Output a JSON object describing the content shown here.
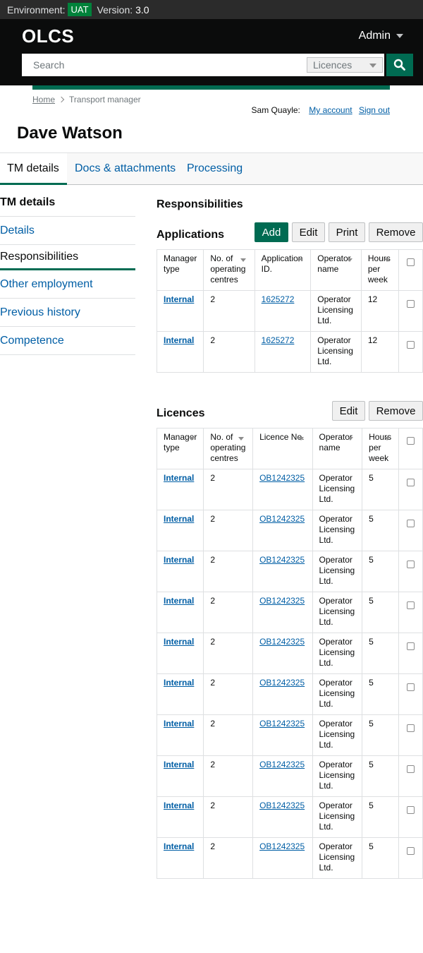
{
  "env": {
    "label": "Environment:",
    "badge": "UAT",
    "version_label": "Version:",
    "version": "3.0"
  },
  "header": {
    "logo": "OLCS",
    "admin": "Admin",
    "search_placeholder": "Search",
    "search_scope": "Licences"
  },
  "breadcrumb": {
    "home": "Home",
    "current": "Transport manager"
  },
  "user": {
    "name": "Sam Quayle:",
    "my_account": "My account",
    "sign_out": "Sign out"
  },
  "page_title": "Dave Watson",
  "tabs": [
    {
      "label": "TM details"
    },
    {
      "label": "Docs & attachments"
    },
    {
      "label": "Processing"
    }
  ],
  "sidenav": {
    "heading": "TM details",
    "items": [
      {
        "label": "Details"
      },
      {
        "label": "Responsibilities"
      },
      {
        "label": "Other employment"
      },
      {
        "label": "Previous history"
      },
      {
        "label": "Competence"
      }
    ]
  },
  "responsibilities_title": "Responsibilities",
  "applications": {
    "title": "Applications",
    "buttons": {
      "add": "Add",
      "edit": "Edit",
      "print": "Print",
      "remove": "Remove"
    },
    "headers": {
      "manager_type": "Manager type",
      "centres": "No. of operating centres",
      "app_id": "Application ID.",
      "operator": "Operator name",
      "hours": "Hours per week"
    },
    "rows": [
      {
        "manager_type": "Internal",
        "centres": "2",
        "app_id": "1625272",
        "operator": "Operator Licensing Ltd.",
        "hours": "12"
      },
      {
        "manager_type": "Internal",
        "centres": "2",
        "app_id": "1625272",
        "operator": "Operator Licensing Ltd.",
        "hours": "12"
      }
    ]
  },
  "licences": {
    "title": "Licences",
    "buttons": {
      "edit": "Edit",
      "remove": "Remove"
    },
    "headers": {
      "manager_type": "Manager type",
      "centres": "No. of operating centres",
      "lic_no": "Licence No.",
      "operator": "Operator name",
      "hours": "Hours per week"
    },
    "rows": [
      {
        "manager_type": "Internal",
        "centres": "2",
        "lic_no": "OB1242325",
        "operator": "Operator Licensing Ltd.",
        "hours": "5"
      },
      {
        "manager_type": "Internal",
        "centres": "2",
        "lic_no": "OB1242325",
        "operator": "Operator Licensing Ltd.",
        "hours": "5"
      },
      {
        "manager_type": "Internal",
        "centres": "2",
        "lic_no": "OB1242325",
        "operator": "Operator Licensing Ltd.",
        "hours": "5"
      },
      {
        "manager_type": "Internal",
        "centres": "2",
        "lic_no": "OB1242325",
        "operator": "Operator Licensing Ltd.",
        "hours": "5"
      },
      {
        "manager_type": "Internal",
        "centres": "2",
        "lic_no": "OB1242325",
        "operator": "Operator Licensing Ltd.",
        "hours": "5"
      },
      {
        "manager_type": "Internal",
        "centres": "2",
        "lic_no": "OB1242325",
        "operator": "Operator Licensing Ltd.",
        "hours": "5"
      },
      {
        "manager_type": "Internal",
        "centres": "2",
        "lic_no": "OB1242325",
        "operator": "Operator Licensing Ltd.",
        "hours": "5"
      },
      {
        "manager_type": "Internal",
        "centres": "2",
        "lic_no": "OB1242325",
        "operator": "Operator Licensing Ltd.",
        "hours": "5"
      },
      {
        "manager_type": "Internal",
        "centres": "2",
        "lic_no": "OB1242325",
        "operator": "Operator Licensing Ltd.",
        "hours": "5"
      },
      {
        "manager_type": "Internal",
        "centres": "2",
        "lic_no": "OB1242325",
        "operator": "Operator Licensing Ltd.",
        "hours": "5"
      }
    ]
  },
  "colors": {
    "brand_green": "#006b52",
    "link_blue": "#005ea5",
    "header_black": "#0b0c0c"
  }
}
